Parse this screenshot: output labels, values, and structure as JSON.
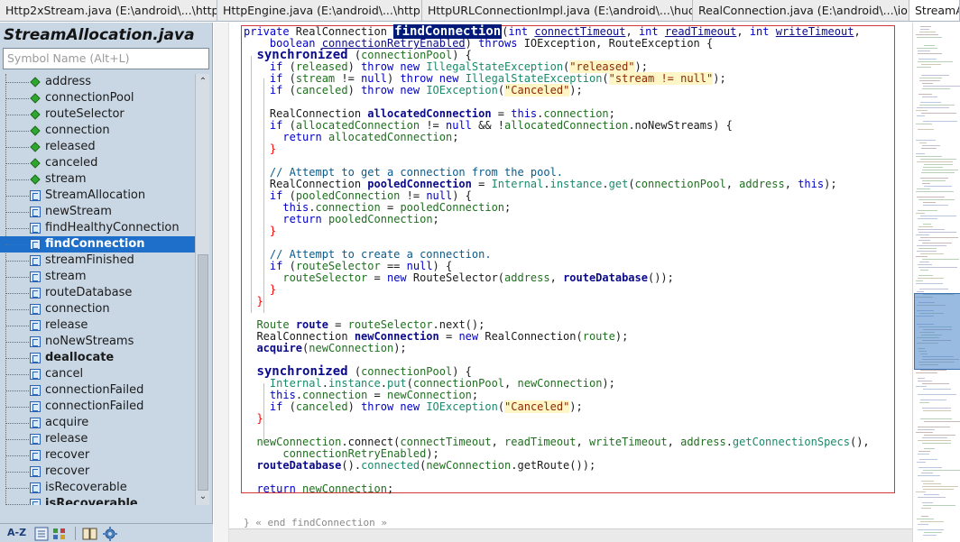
{
  "tabs": [
    {
      "label": "Http2xStream.java (E:\\android\\...\\http)"
    },
    {
      "label": "HttpEngine.java (E:\\android\\...\\http)"
    },
    {
      "label": "HttpURLConnectionImpl.java (E:\\android\\...\\huc)"
    },
    {
      "label": "RealConnection.java (E:\\android\\...\\io)"
    },
    {
      "label": "StreamAl"
    }
  ],
  "symbol_panel": {
    "file_title": "StreamAllocation.java",
    "search_placeholder": "Symbol Name (Alt+L)",
    "items": [
      {
        "label": "address",
        "kind": "field"
      },
      {
        "label": "connectionPool",
        "kind": "field"
      },
      {
        "label": "routeSelector",
        "kind": "field"
      },
      {
        "label": "connection",
        "kind": "field"
      },
      {
        "label": "released",
        "kind": "field"
      },
      {
        "label": "canceled",
        "kind": "field"
      },
      {
        "label": "stream",
        "kind": "field"
      },
      {
        "label": "StreamAllocation",
        "kind": "method"
      },
      {
        "label": "newStream",
        "kind": "method"
      },
      {
        "label": "findHealthyConnection",
        "kind": "method"
      },
      {
        "label": "findConnection",
        "kind": "method",
        "selected": true
      },
      {
        "label": "streamFinished",
        "kind": "method"
      },
      {
        "label": "stream",
        "kind": "method"
      },
      {
        "label": "routeDatabase",
        "kind": "method"
      },
      {
        "label": "connection",
        "kind": "method"
      },
      {
        "label": "release",
        "kind": "method"
      },
      {
        "label": "noNewStreams",
        "kind": "method"
      },
      {
        "label": "deallocate",
        "kind": "method",
        "bold": true
      },
      {
        "label": "cancel",
        "kind": "method"
      },
      {
        "label": "connectionFailed",
        "kind": "method"
      },
      {
        "label": "connectionFailed",
        "kind": "method"
      },
      {
        "label": "acquire",
        "kind": "method"
      },
      {
        "label": "release",
        "kind": "method"
      },
      {
        "label": "recover",
        "kind": "method"
      },
      {
        "label": "recover",
        "kind": "method"
      },
      {
        "label": "isRecoverable",
        "kind": "method"
      },
      {
        "label": "isRecoverable",
        "kind": "method",
        "bold": true
      }
    ],
    "toolbar": {
      "sort_label": "A-Z"
    }
  },
  "editor": {
    "end_note": "} « end findConnection »"
  },
  "colors": {
    "selection": "#1e6fc9",
    "panel": "#c9d7e5",
    "frame": "#d23a3a",
    "keyword": "#0000c8"
  }
}
